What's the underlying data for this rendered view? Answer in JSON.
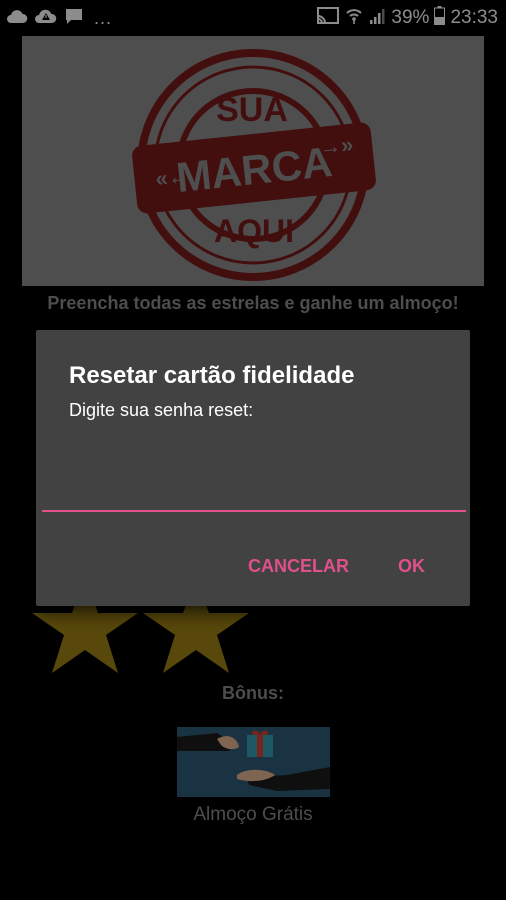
{
  "status_bar": {
    "battery": "39%",
    "time": "23:33",
    "overflow": "...",
    "left_icons": [
      "cloud-icon",
      "alert-cloud-icon",
      "message-icon"
    ],
    "right_icons": [
      "cast-icon",
      "wifi-icon",
      "signal-icon",
      "battery-icon"
    ]
  },
  "banner": {
    "line_top": "SUA",
    "line_middle": "MARCA",
    "line_bottom": "AQUI",
    "stamp_color": "#7a1b1b"
  },
  "instruction": "Preencha todas as estrelas e ganhe um almoço!",
  "stars": {
    "color": "#a08415"
  },
  "bonus": {
    "label": "Bônus:",
    "caption": "Almoço Grátis"
  },
  "dialog": {
    "title": "Resetar cartão fidelidade",
    "message": "Digite sua senha reset:",
    "input_value": "",
    "cancel_label": "CANCELAR",
    "ok_label": "OK",
    "accent_color": "#e0508a"
  }
}
